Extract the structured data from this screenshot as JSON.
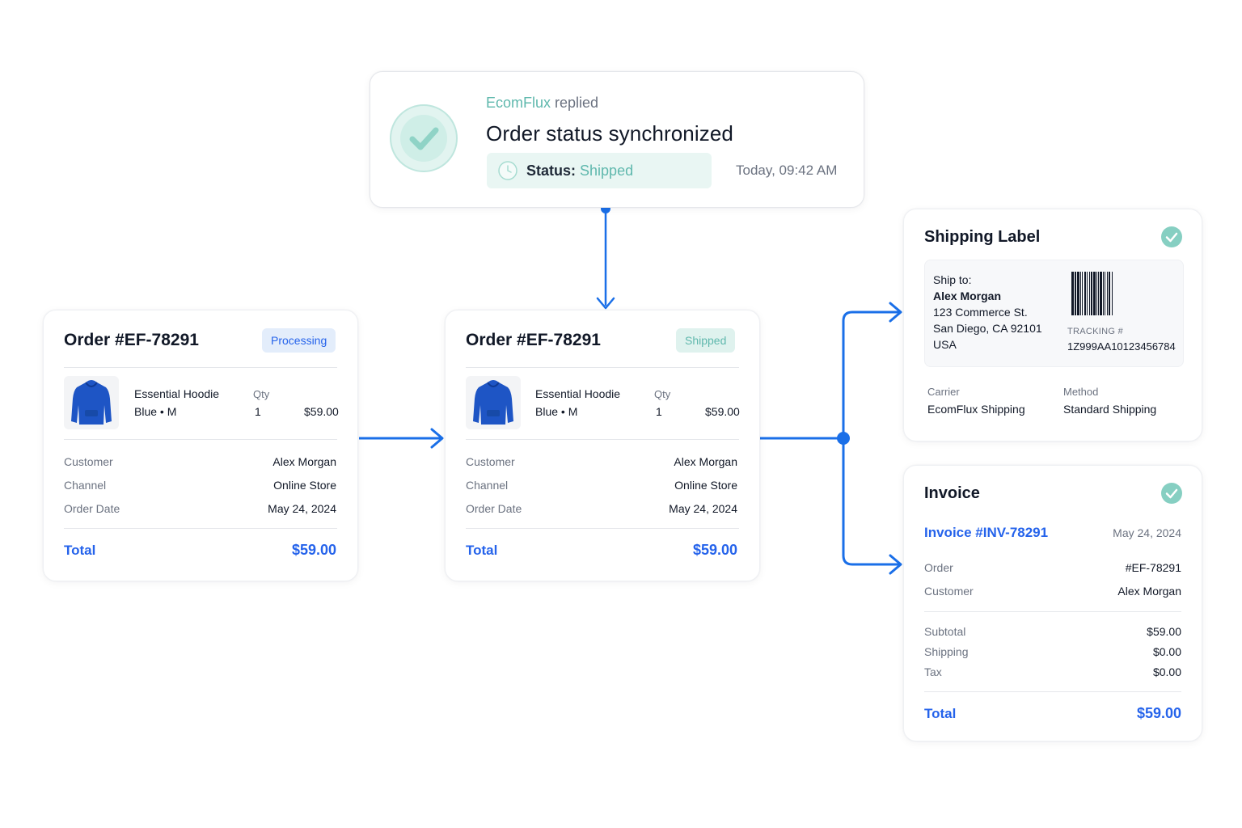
{
  "notification": {
    "brand": "EcomFlux",
    "action": "replied",
    "title": "Order status synchronized",
    "status_label": "Status:",
    "status_value": "Shipped",
    "time": "Today, 09:42 AM"
  },
  "order_before": {
    "title": "Order #EF-78291",
    "badge": "Processing",
    "item_name": "Essential Hoodie",
    "item_variant": "Blue • M",
    "qty_label": "Qty",
    "qty": "1",
    "price": "$59.00",
    "rows": [
      {
        "label": "Customer",
        "value": "Alex Morgan"
      },
      {
        "label": "Channel",
        "value": "Online Store"
      },
      {
        "label": "Order Date",
        "value": "May 24, 2024"
      }
    ],
    "total_label": "Total",
    "total_value": "$59.00"
  },
  "order_after": {
    "title": "Order #EF-78291",
    "badge": "Shipped",
    "item_name": "Essential Hoodie",
    "item_variant": "Blue • M",
    "qty_label": "Qty",
    "qty": "1",
    "price": "$59.00",
    "rows": [
      {
        "label": "Customer",
        "value": "Alex Morgan"
      },
      {
        "label": "Channel",
        "value": "Online Store"
      },
      {
        "label": "Order Date",
        "value": "May 24, 2024"
      }
    ],
    "total_label": "Total",
    "total_value": "$59.00"
  },
  "shipping_label": {
    "title": "Shipping Label",
    "ship_to_label": "Ship to:",
    "name": "Alex Morgan",
    "address1": "123 Commerce St.",
    "address2": "San Diego, CA 92101",
    "country": "USA",
    "tracking_label": "TRACKING #",
    "tracking_number": "1Z999AA10123456784",
    "carrier_label": "Carrier",
    "carrier_value": "EcomFlux Shipping",
    "method_label": "Method",
    "method_value": "Standard Shipping"
  },
  "invoice": {
    "title": "Invoice",
    "number": "Invoice #INV-78291",
    "date": "May 24, 2024",
    "order_label": "Order",
    "order_value": "#EF-78291",
    "customer_label": "Customer",
    "customer_value": "Alex Morgan",
    "subtotal_label": "Subtotal",
    "subtotal_value": "$59.00",
    "shipping_label": "Shipping",
    "shipping_value": "$0.00",
    "tax_label": "Tax",
    "tax_value": "$0.00",
    "total_label": "Total",
    "total_value": "$59.00"
  },
  "colors": {
    "accent_blue": "#2563eb",
    "connector_blue": "#1a6fe8",
    "success_teal": "#5fb8ad"
  },
  "icons": [
    "check-circle-icon",
    "clock-icon",
    "hoodie-icon",
    "barcode-icon",
    "arrow-icon"
  ]
}
